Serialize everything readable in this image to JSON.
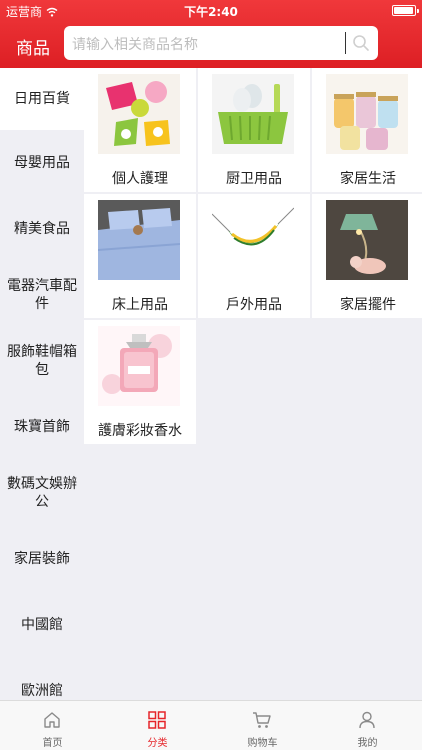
{
  "status_bar": {
    "carrier": "运营商",
    "time": "下午2:40",
    "battery_level": 0.95
  },
  "nav": {
    "title": "商品",
    "search_placeholder": "请输入相关商品名称"
  },
  "sidebar": {
    "items": [
      {
        "label": "日用百貨",
        "active": true
      },
      {
        "label": "母嬰用品"
      },
      {
        "label": "精美食品"
      },
      {
        "label": "電器汽車配件"
      },
      {
        "label": "服飾鞋帽箱包"
      },
      {
        "label": "珠寶首飾"
      },
      {
        "label": "數碼文娛辦公"
      },
      {
        "label": "家居裝飾"
      },
      {
        "label": "中國館"
      },
      {
        "label": "歐洲館"
      }
    ]
  },
  "grid": {
    "items": [
      {
        "label": "個人護理",
        "icon": "personal-care-products-image"
      },
      {
        "label": "厨卫用品",
        "icon": "dish-rack-image"
      },
      {
        "label": "家居生活",
        "icon": "mason-jars-image"
      },
      {
        "label": "床上用品",
        "icon": "bedding-image"
      },
      {
        "label": "戶外用品",
        "icon": "hammock-image"
      },
      {
        "label": "家居擺件",
        "icon": "decor-lamp-image"
      },
      {
        "label": "護膚彩妝香水",
        "icon": "perfume-bottle-image"
      }
    ]
  },
  "tabbar": {
    "items": [
      {
        "label": "首页",
        "icon": "home-icon"
      },
      {
        "label": "分类",
        "icon": "category-icon",
        "active": true
      },
      {
        "label": "购物车",
        "icon": "cart-icon"
      },
      {
        "label": "我的",
        "icon": "profile-icon"
      }
    ]
  },
  "colors": {
    "brand_red": "#e6252a",
    "background": "#efeff4"
  }
}
